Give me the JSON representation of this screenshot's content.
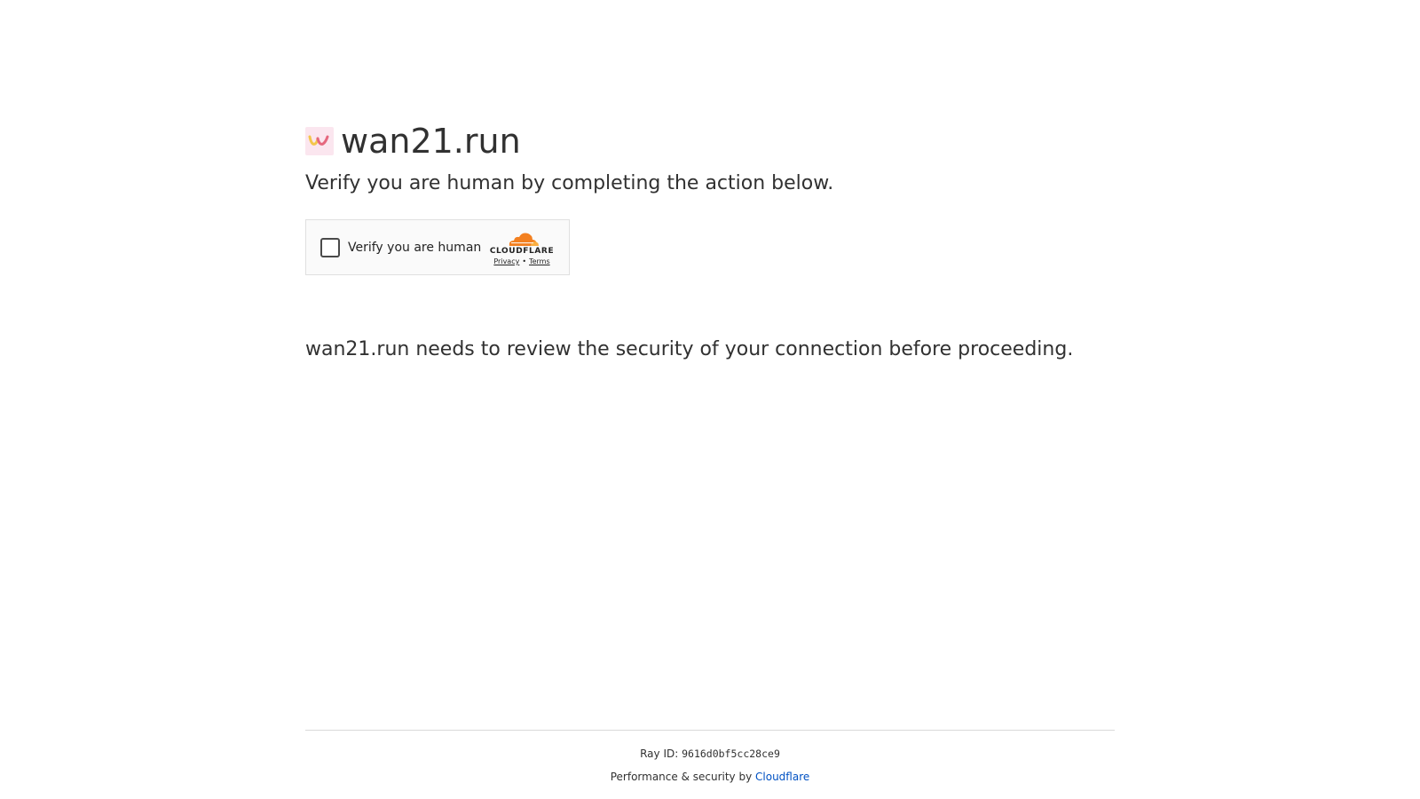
{
  "site": {
    "title": "wan21.run",
    "logo_icon": "wan-logo-icon"
  },
  "subtitle": "Verify you are human by completing the action below.",
  "challenge": {
    "checkbox_label": "Verify you are human",
    "brand": "CLOUDFLARE",
    "privacy_link": "Privacy",
    "separator": "•",
    "terms_link": "Terms",
    "checked": false
  },
  "review_text": "wan21.run needs to review the security of your connection before proceeding.",
  "footer": {
    "ray_label": "Ray ID: ",
    "ray_id": "9616d0bf5cc28ce9",
    "perf_label": "Performance & security by ",
    "perf_link": "Cloudflare"
  },
  "colors": {
    "text": "#313131",
    "link": "#0051c3",
    "cloudflare_orange": "#f38020",
    "cloudflare_light_orange": "#faae40"
  }
}
